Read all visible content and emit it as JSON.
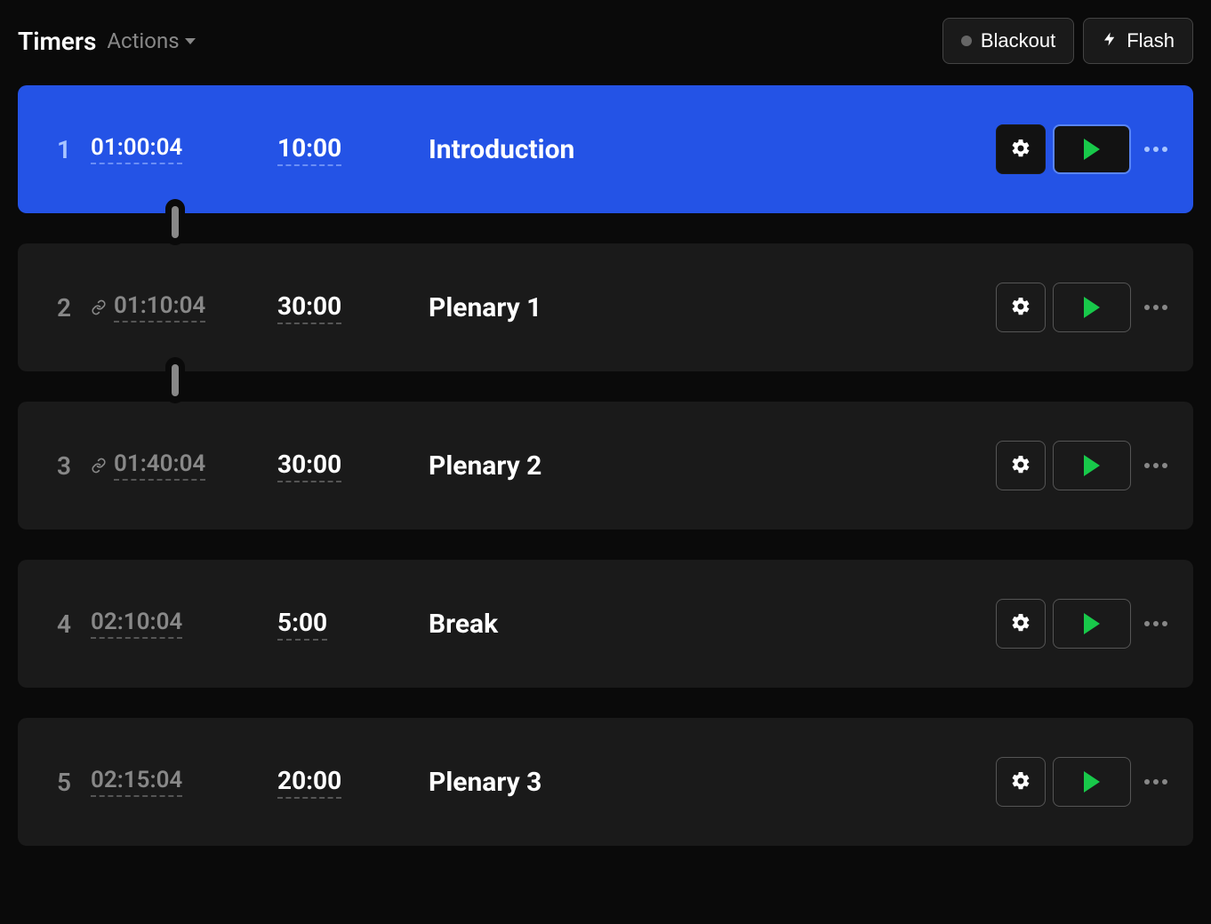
{
  "header": {
    "title": "Timers",
    "actions_label": "Actions",
    "blackout_label": "Blackout",
    "flash_label": "Flash"
  },
  "timers": [
    {
      "index": "1",
      "start": "01:00:04",
      "linked": false,
      "duration": "10:00",
      "name": "Introduction",
      "active": true,
      "connector_after": true
    },
    {
      "index": "2",
      "start": "01:10:04",
      "linked": true,
      "duration": "30:00",
      "name": "Plenary 1",
      "active": false,
      "connector_after": true
    },
    {
      "index": "3",
      "start": "01:40:04",
      "linked": true,
      "duration": "30:00",
      "name": "Plenary 2",
      "active": false,
      "connector_after": false
    },
    {
      "index": "4",
      "start": "02:10:04",
      "linked": false,
      "duration": "5:00",
      "name": "Break",
      "active": false,
      "connector_after": false
    },
    {
      "index": "5",
      "start": "02:15:04",
      "linked": false,
      "duration": "20:00",
      "name": "Plenary 3",
      "active": false,
      "connector_after": false
    }
  ]
}
